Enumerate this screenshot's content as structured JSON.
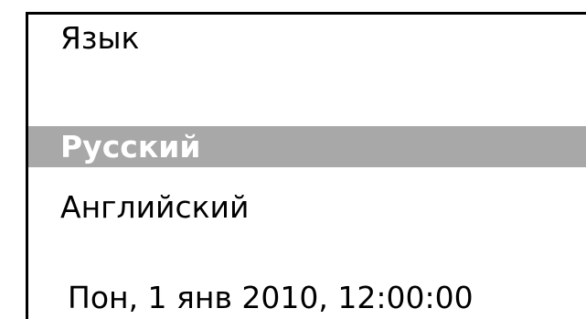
{
  "menu": {
    "title": "Язык",
    "items": [
      {
        "label": "Русский",
        "selected": true
      },
      {
        "label": "Английский",
        "selected": false
      }
    ]
  },
  "status": {
    "datetime": "Пон, 1 янв 2010, 12:00:00"
  },
  "colors": {
    "selection_background": "#a8a8a8",
    "selected_text": "#ffffff",
    "text": "#000000",
    "frame": "#000000",
    "background": "#ffffff"
  }
}
